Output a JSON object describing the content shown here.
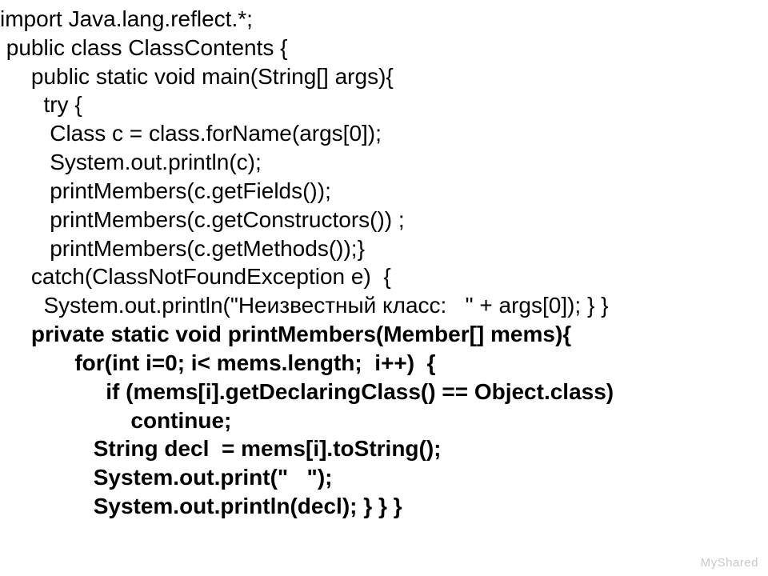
{
  "code": {
    "l1": "import Java.lang.reflect.*;",
    "l2": " public class ClassContents {",
    "l3": "     public static void main(String[] args){",
    "l4": "       try {",
    "l5": "        Class c = class.forName(args[0]);",
    "l6": "        System.out.println(c);",
    "l7": "        printMembers(c.getFields());",
    "l8": "        printMembers(c.getConstructors()) ;",
    "l9": "        printMembers(c.getMethods());}",
    "l10": "     catch(ClassNotFoundException e)  {",
    "l11": "       System.out.println(\"Неизвестный класс:   \" + args[0]); } }",
    "l12": "     private static void printMembers(Member[] mems){",
    "l13": "            for(int i=0; i< mems.length;  i++)  {",
    "l14": "                 if (mems[i].getDeclaringClass() == Object.class)",
    "l15": "                     continue;",
    "l16": "               String decl  = mems[i].toString();",
    "l17": "               System.out.print(\"   \");",
    "l18": "               System.out.println(decl); } } }"
  },
  "watermark": "MyShared"
}
